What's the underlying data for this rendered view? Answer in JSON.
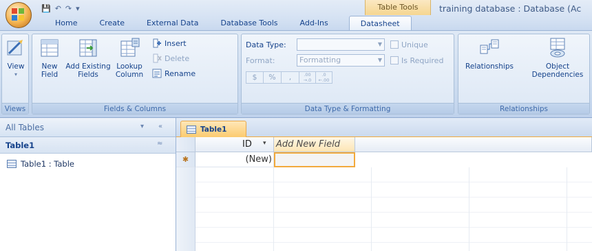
{
  "title": {
    "window_title": "training database : Database (Ac",
    "contextual_label": "Table Tools"
  },
  "quick_access": {
    "save": "💾",
    "undo": "↶",
    "redo": "↷",
    "customize": "▾"
  },
  "tabs": [
    {
      "label": "Home"
    },
    {
      "label": "Create"
    },
    {
      "label": "External Data"
    },
    {
      "label": "Database Tools"
    },
    {
      "label": "Add-Ins"
    },
    {
      "label": "Datasheet"
    }
  ],
  "ribbon": {
    "views": {
      "view_label": "View",
      "view_arrow": "▾",
      "group_label": "Views"
    },
    "fields_columns": {
      "new_field": [
        "New",
        "Field"
      ],
      "add_existing": [
        "Add Existing",
        "Fields"
      ],
      "lookup": [
        "Lookup",
        "Column"
      ],
      "insert": "Insert",
      "delete": "Delete",
      "rename": "Rename",
      "group_label": "Fields & Columns"
    },
    "data_type": {
      "data_type_label": "Data Type:",
      "data_type_value": "",
      "format_label": "Format:",
      "format_value": "Formatting",
      "unique_label": "Unique",
      "required_label": "Is Required",
      "currency": "$",
      "percent": "%",
      "comma": ",",
      "inc_decimal": ".00\n→.0",
      "dec_decimal": ".0\n←.00",
      "group_label": "Data Type & Formatting"
    },
    "relationships": {
      "relationships": "Relationships",
      "object_dependencies": [
        "Object",
        "Dependencies"
      ],
      "group_label": "Relationships"
    }
  },
  "nav": {
    "title": "All Tables",
    "dropdown": "▾",
    "collapse": "«",
    "group": "Table1",
    "group_collapse": "≈",
    "items": [
      {
        "label": "Table1 : Table"
      }
    ]
  },
  "document": {
    "tab_label": "Table1",
    "columns": [
      {
        "label": "ID",
        "sort": "▾"
      },
      {
        "label": "Add New Field"
      }
    ],
    "new_row_marker": "✱",
    "new_row_value": "(New)"
  },
  "colors": {
    "accent": "#f2a93b",
    "ribbon_text": "#15428b"
  }
}
